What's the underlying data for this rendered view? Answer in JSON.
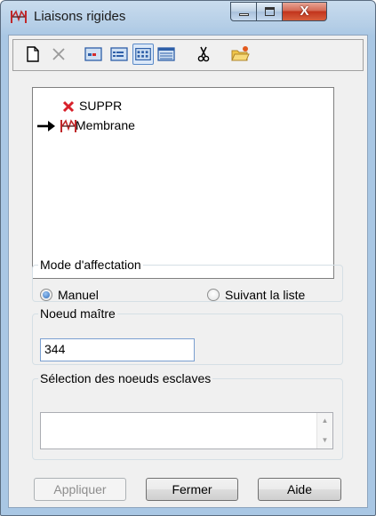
{
  "window": {
    "title": "Liaisons rigides",
    "close_glyph": "X"
  },
  "toolbar": {
    "icons": [
      "new-document-icon",
      "delete-icon",
      "view-small-icon",
      "view-list-icon",
      "view-grid-icon",
      "view-details-icon",
      "cut-icon",
      "open-folder-icon"
    ],
    "pressed": "view-grid-icon"
  },
  "tree": {
    "items": [
      {
        "label": "SUPPR",
        "icon": "red-x-icon",
        "marked": false
      },
      {
        "label": "Membrane",
        "icon": "rigid-link-icon",
        "marked": true
      }
    ]
  },
  "mode": {
    "legend": "Mode d'affectation",
    "options": [
      {
        "label": "Manuel",
        "selected": true
      },
      {
        "label": "Suivant la liste",
        "selected": false
      }
    ]
  },
  "master": {
    "legend": "Noeud maître",
    "value": "344"
  },
  "slaves": {
    "legend": "Sélection des noeuds esclaves",
    "value": ""
  },
  "buttons": {
    "apply": "Appliquer",
    "close": "Fermer",
    "help": "Aide"
  },
  "colors": {
    "accent": "#3c73c8",
    "close_red": "#c2341c",
    "delete_red": "#d8202a"
  }
}
